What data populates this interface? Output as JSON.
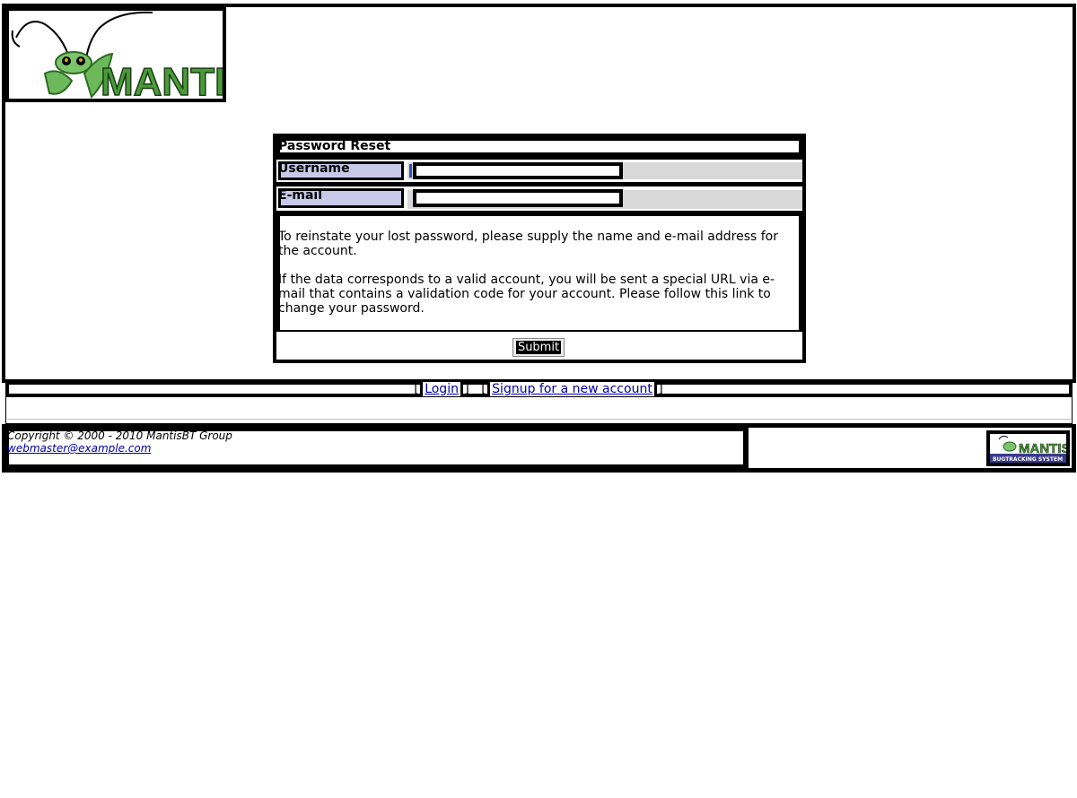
{
  "logo": {
    "text": "MANTIS",
    "icon": "mantis-logo"
  },
  "form": {
    "title": "Password Reset",
    "username_label": "Username",
    "username_value": "",
    "email_label": "E-mail",
    "email_value": "",
    "description_1": "To reinstate your lost password, please supply the name and e-mail address for the account.",
    "description_2": "If the data corresponds to a valid account, you will be sent a special URL via e-mail that contains a validation code for your account. Please follow this link to change your password.",
    "submit_label": "Submit"
  },
  "menu": {
    "login_label": "Login",
    "signup_label": "Signup for a new account",
    "open_bracket": "[",
    "close_bracket": "]"
  },
  "footer": {
    "copyright": "Copyright © 2000 - 2010 MantisBT Group",
    "webmaster_email": "webmaster@example.com",
    "powered_logo_text": "MANTIS",
    "powered_logo_subtext": "BUGTRACKING SYSTEM"
  },
  "colors": {
    "label_bg": "#c8c8e8",
    "input_row_bg": "#d8d8d8",
    "link": "#0000aa",
    "logo_green": "#4a9a3a"
  }
}
